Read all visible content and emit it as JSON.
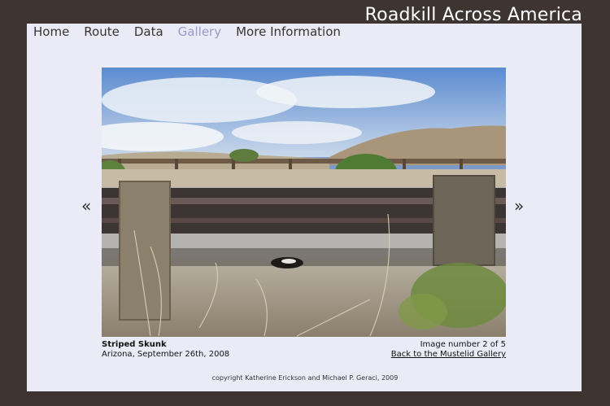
{
  "site": {
    "title": "Roadkill Across America"
  },
  "nav": {
    "items": [
      {
        "label": "Home"
      },
      {
        "label": "Route"
      },
      {
        "label": "Data"
      },
      {
        "label": "Gallery"
      },
      {
        "label": "More Information"
      }
    ],
    "active": "Gallery"
  },
  "viewer": {
    "prev_label": "«",
    "next_label": "»",
    "photo_subject": "Striped Skunk"
  },
  "caption": {
    "name": "Striped Skunk",
    "place_date": "Arizona, September 26th, 2008",
    "counter": "Image number 2 of 5",
    "back_link": "Back to the Mustelid Gallery"
  },
  "footer": {
    "copyright": "copyright Katherine Erickson and Michael P. Geraci, 2009"
  },
  "colors": {
    "background": "#3e3431",
    "panel": "#ebebf7",
    "nav_active": "#9a9ac9"
  }
}
